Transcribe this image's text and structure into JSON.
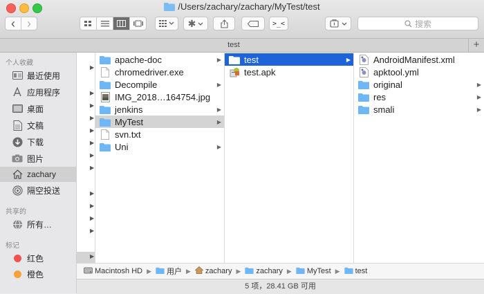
{
  "window": {
    "title": "/Users/zachary/zachary/MyTest/test"
  },
  "toolbar": {
    "back_glyph": "‹",
    "forward_glyph": "›",
    "search_placeholder": "搜索"
  },
  "tabbar": {
    "tab_label": "test",
    "add_glyph": "+"
  },
  "sidebar": {
    "favorites_header": "个人收藏",
    "favorites": [
      {
        "label": "最近使用",
        "icon": "recents-icon"
      },
      {
        "label": "应用程序",
        "icon": "applications-icon"
      },
      {
        "label": "桌面",
        "icon": "desktop-icon"
      },
      {
        "label": "文稿",
        "icon": "documents-icon"
      },
      {
        "label": "下载",
        "icon": "downloads-icon"
      },
      {
        "label": "图片",
        "icon": "pictures-icon"
      },
      {
        "label": "zachary",
        "icon": "home-icon",
        "selected": true
      },
      {
        "label": "隔空投送",
        "icon": "airdrop-icon"
      }
    ],
    "shared_header": "共享的",
    "shared": [
      {
        "label": "所有…",
        "icon": "network-icon"
      }
    ],
    "tags_header": "标记",
    "tags": [
      {
        "label": "红色",
        "color": "#f0524f"
      },
      {
        "label": "橙色",
        "color": "#f6a33a"
      }
    ]
  },
  "column2": [
    {
      "name": "apache-doc",
      "type": "folder",
      "arrow": true
    },
    {
      "name": "chromedriver.exe",
      "type": "file",
      "arrow": false
    },
    {
      "name": "Decompile",
      "type": "folder",
      "arrow": true
    },
    {
      "name": "IMG_2018…164754.jpg",
      "type": "image",
      "arrow": false
    },
    {
      "name": "jenkins",
      "type": "folder",
      "arrow": true
    },
    {
      "name": "MyTest",
      "type": "folder",
      "arrow": true,
      "state": "gray"
    },
    {
      "name": "svn.txt",
      "type": "file",
      "arrow": false
    },
    {
      "name": "Uni",
      "type": "folder",
      "arrow": true
    }
  ],
  "column3": [
    {
      "name": "test",
      "type": "folder",
      "arrow": true,
      "state": "blue"
    },
    {
      "name": "test.apk",
      "type": "apk",
      "arrow": false
    }
  ],
  "column4": [
    {
      "name": "AndroidManifest.xml",
      "type": "xml",
      "arrow": false
    },
    {
      "name": "apktool.yml",
      "type": "xml",
      "arrow": false
    },
    {
      "name": "original",
      "type": "folder",
      "arrow": true
    },
    {
      "name": "res",
      "type": "folder",
      "arrow": true
    },
    {
      "name": "smali",
      "type": "folder",
      "arrow": true
    }
  ],
  "pathbar": [
    {
      "label": "Macintosh HD",
      "icon": "disk-icon"
    },
    {
      "label": "用户",
      "icon": "folder-icon"
    },
    {
      "label": "zachary",
      "icon": "home-icon"
    },
    {
      "label": "zachary",
      "icon": "folder-icon"
    },
    {
      "label": "MyTest",
      "icon": "folder-icon"
    },
    {
      "label": "test",
      "icon": "folder-icon"
    }
  ],
  "statusbar": {
    "text": "5 项，28.41 GB 可用"
  },
  "colors": {
    "accent": "#1d63d9",
    "folder": "#6fb6f3",
    "selected_gray": "#d4d4d4"
  }
}
